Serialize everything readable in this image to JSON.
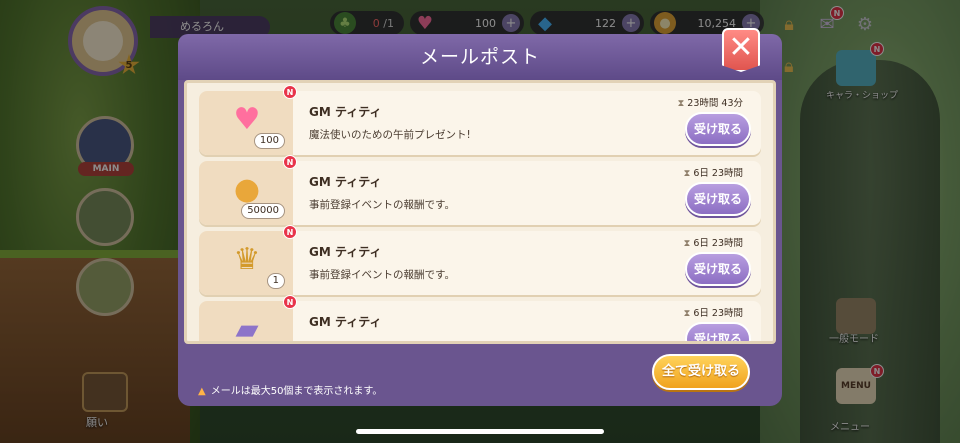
{
  "hud": {
    "player_name": "めるろん",
    "level": "5",
    "stamina": {
      "current": "0",
      "max": "/1"
    },
    "hearts": "100",
    "gems": "122",
    "coins": "10,254"
  },
  "side": {
    "main_label": "MAIN",
    "wish_label": "願い",
    "shop_label": "キャラ・ショップ",
    "mode_label": "一般モード",
    "menu_text": "MENU",
    "menu_label": "メニュー"
  },
  "modal": {
    "title": "メールポスト",
    "close_glyph": "✕",
    "notice": "メールは最大50個まで表示されます。",
    "claim_all_label": "全て受け取る",
    "new_badge": "N",
    "mails": [
      {
        "icon": "heart-item-icon",
        "quantity": "100",
        "sender": "GM ティティ",
        "message": "魔法使いのための午前プレゼント!",
        "time_left": "23時間 43分",
        "button": "受け取る"
      },
      {
        "icon": "coin-item-icon",
        "quantity": "50000",
        "sender": "GM ティティ",
        "message": "事前登録イベントの報酬です。",
        "time_left": "6日 23時間",
        "button": "受け取る"
      },
      {
        "icon": "treasure-box-icon",
        "quantity": "1",
        "sender": "GM ティティ",
        "message": "事前登録イベントの報酬です。",
        "time_left": "6日 23時間",
        "button": "受け取る"
      },
      {
        "icon": "ticket-item-icon",
        "quantity": "",
        "sender": "GM ティティ",
        "message": "",
        "time_left": "6日 23時間",
        "button": "受け取る"
      }
    ]
  },
  "colors": {
    "modal_header": "#7f69a8",
    "receive_button": "#a287d2",
    "claim_all_button": "#f5b62f",
    "close_button": "#e8605a",
    "badge": "#e8344a"
  }
}
